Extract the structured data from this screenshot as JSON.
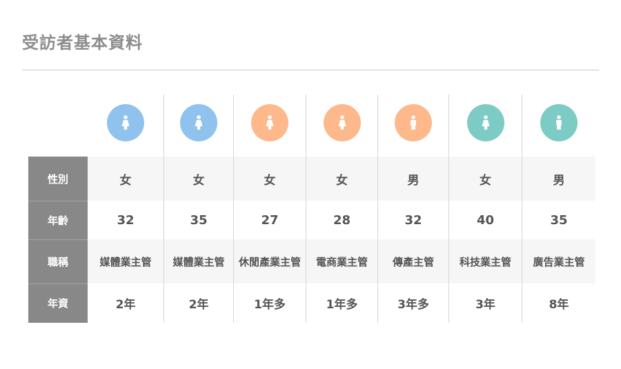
{
  "title": "受訪者基本資料",
  "row_labels": {
    "gender": "性別",
    "age": "年齡",
    "title": "職稱",
    "seniority": "年資"
  },
  "colors": {
    "blue": "#8fc3ee",
    "orange": "#fdb98c",
    "teal": "#7dcbc5"
  },
  "respondents": [
    {
      "avatar_color": "#8fc3ee",
      "icon": "female-icon",
      "gender": "女",
      "age": "32",
      "title": "媒體業主管",
      "seniority": "2年"
    },
    {
      "avatar_color": "#8fc3ee",
      "icon": "female-icon",
      "gender": "女",
      "age": "35",
      "title": "媒體業主管",
      "seniority": "2年"
    },
    {
      "avatar_color": "#fdb98c",
      "icon": "female-icon",
      "gender": "女",
      "age": "27",
      "title": "休閒產業主管",
      "seniority": "1年多"
    },
    {
      "avatar_color": "#fdb98c",
      "icon": "female-icon",
      "gender": "女",
      "age": "28",
      "title": "電商業主管",
      "seniority": "1年多"
    },
    {
      "avatar_color": "#fdb98c",
      "icon": "male-icon",
      "gender": "男",
      "age": "32",
      "title": "傳產主管",
      "seniority": "3年多"
    },
    {
      "avatar_color": "#7dcbc5",
      "icon": "female-icon",
      "gender": "女",
      "age": "40",
      "title": "科技業主管",
      "seniority": "3年"
    },
    {
      "avatar_color": "#7dcbc5",
      "icon": "male-icon",
      "gender": "男",
      "age": "35",
      "title": "廣告業主管",
      "seniority": "8年"
    }
  ]
}
